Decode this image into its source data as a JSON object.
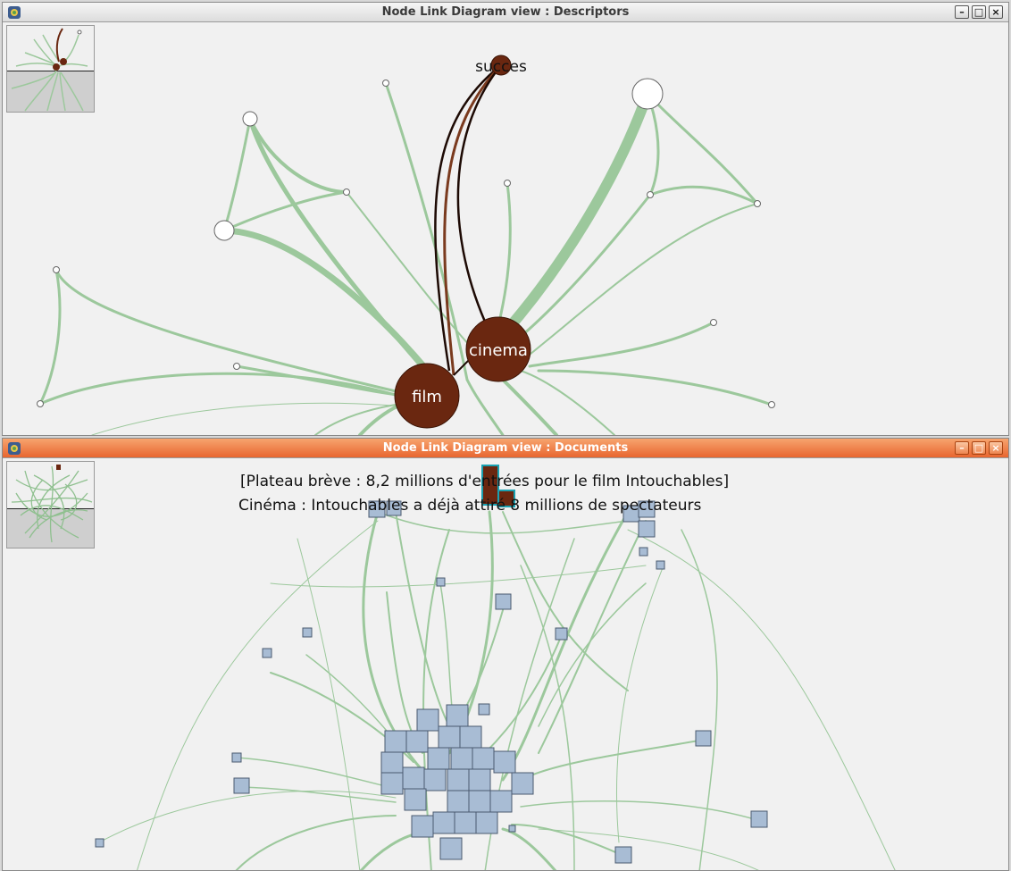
{
  "descriptors_window": {
    "title": "Node Link Diagram view : Descriptors",
    "nodes": {
      "succes": "succes",
      "cinema": "cinema",
      "film": "film"
    }
  },
  "documents_window": {
    "title": "Node Link Diagram view : Documents",
    "labels": [
      "[Plateau brève : 8,2 millions d'entrées pour le film Intouchables]",
      "Cinéma : Intouchables a déjà attiré 8 millions de spectateurs"
    ]
  },
  "window_buttons": {
    "minimize": "–",
    "maximize": "□",
    "close": "×"
  },
  "colors": {
    "edge_green": "#9cc89c",
    "selected_node": "#6a2710",
    "document_node": "#a8bcd4",
    "docs_titlebar": "#ec7438"
  },
  "icons": [
    "app-icon",
    "minimize-icon",
    "maximize-icon",
    "close-icon"
  ]
}
